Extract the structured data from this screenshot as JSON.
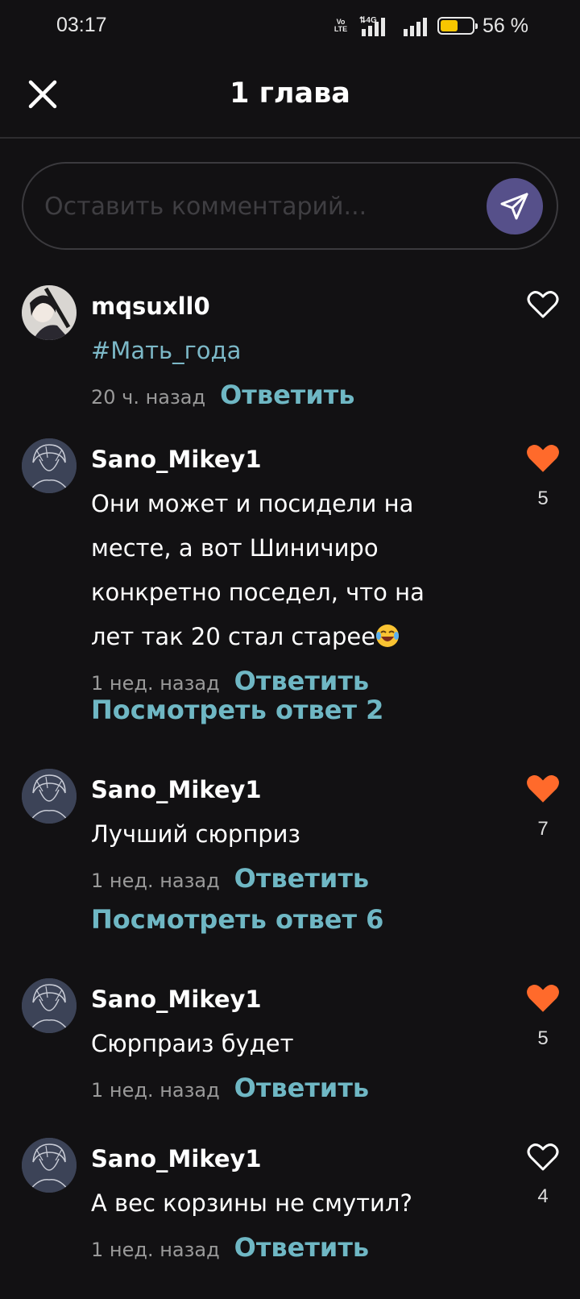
{
  "status": {
    "time": "03:17",
    "network_tag": "Vo LTE",
    "network_type": "4G",
    "battery_percent": "56 %",
    "battery_level": 0.56
  },
  "header": {
    "title": "1 глава"
  },
  "composer": {
    "placeholder": "Оставить комментарий..."
  },
  "comments": [
    {
      "user": "mqsuxll0",
      "text": "#Мать_года",
      "time": "20 ч. назад",
      "reply_label": "Ответить",
      "liked": false,
      "likes": ""
    },
    {
      "user": "Sano_Mikey1",
      "text": "Они может и посидели на месте, а вот Шиничиро конкретно поседел, что на лет так 20 стал старее",
      "time": "1 нед. назад",
      "reply_label": "Ответить",
      "view_replies": "Посмотреть ответ 2",
      "liked": true,
      "likes": "5"
    },
    {
      "user": "Sano_Mikey1",
      "text": "Лучший сюрприз",
      "time": "1 нед. назад",
      "reply_label": "Ответить",
      "view_replies": "Посмотреть ответ 6",
      "liked": true,
      "likes": "7"
    },
    {
      "user": "Sano_Mikey1",
      "text": "Сюрпраиз будет",
      "time": "1 нед. назад",
      "reply_label": "Ответить",
      "liked": true,
      "likes": "5"
    },
    {
      "user": "Sano_Mikey1",
      "text": "А вес корзины не смутил?",
      "time": "1 нед. назад",
      "reply_label": "Ответить",
      "liked": false,
      "likes": "4"
    }
  ],
  "colors": {
    "background": "#121113",
    "accent_link": "#6fb7c4",
    "liked_heart": "#ff6a2b",
    "send_button": "#56508a"
  },
  "icons": {
    "close": "close-icon",
    "send": "send-icon",
    "like": "heart-icon",
    "emoji": "laughing-emoji-icon"
  }
}
